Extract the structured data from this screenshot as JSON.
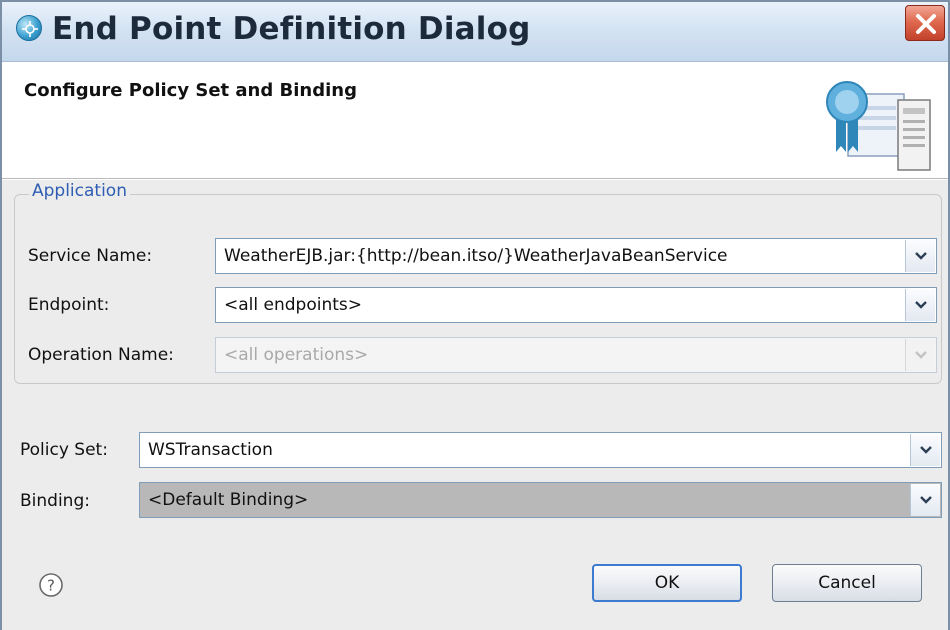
{
  "window": {
    "title": "End Point Definition Dialog",
    "app_icon": "eclipse-ws-icon",
    "close_icon": "close-icon"
  },
  "banner": {
    "title": "Configure Policy Set and Binding",
    "icon": "certificate-ribbon-icon"
  },
  "application": {
    "group_label": "Application",
    "service_name": {
      "label": "Service Name:",
      "value": "WeatherEJB.jar:{http://bean.itso/}WeatherJavaBeanService"
    },
    "endpoint": {
      "label": "Endpoint:",
      "value": "<all endpoints>"
    },
    "operation_name": {
      "label": "Operation Name:",
      "value": "<all operations>",
      "enabled": false
    }
  },
  "policy": {
    "policy_set": {
      "label": "Policy Set:",
      "value": "WSTransaction"
    },
    "binding": {
      "label": "Binding:",
      "value": "<Default Binding>"
    }
  },
  "buttons": {
    "ok_label": "OK",
    "cancel_label": "Cancel",
    "help_icon": "help-icon"
  },
  "colors": {
    "group_legend": "#2e5db3",
    "close_button": "#d9543b",
    "default_button_border": "#3d7bd0"
  }
}
